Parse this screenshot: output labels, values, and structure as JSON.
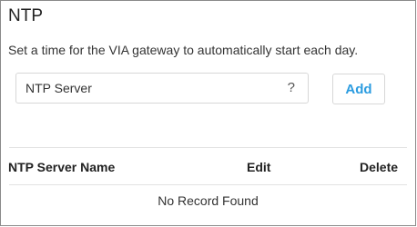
{
  "ntp": {
    "title": "NTP",
    "description": "Set a time for the VIA gateway to automatically start each day.",
    "input": {
      "placeholder": "NTP Server",
      "help": "?"
    },
    "add_label": "Add",
    "table": {
      "columns": [
        "NTP Server Name",
        "Edit",
        "Delete"
      ],
      "empty_message": "No Record Found"
    },
    "colors": {
      "accent": "#2b9ce0",
      "border": "#8a8a8a"
    }
  }
}
